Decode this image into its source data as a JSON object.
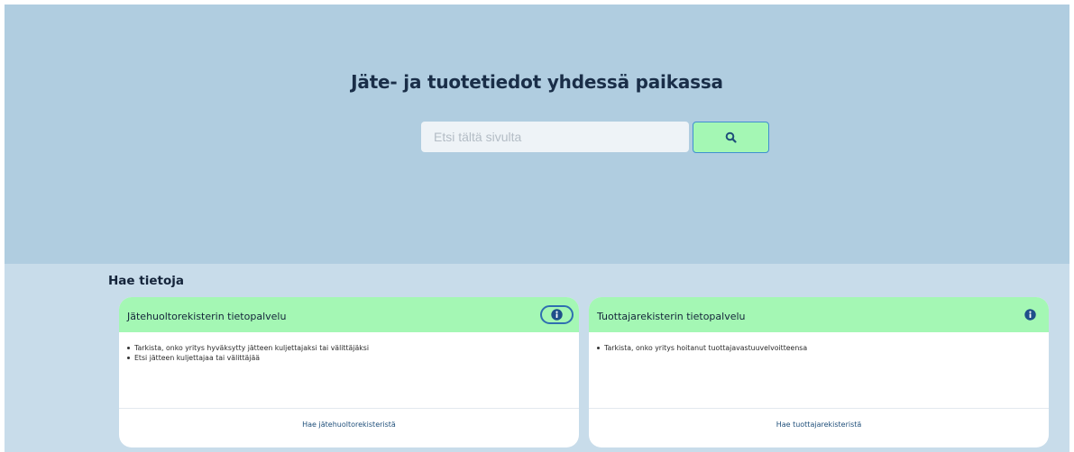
{
  "hero": {
    "title": "Jäte- ja tuotetiedot yhdessä paikassa",
    "search_placeholder": "Etsi tältä sivulta",
    "search_button_icon": "search-icon"
  },
  "section": {
    "title": "Hae tietoja"
  },
  "cards": [
    {
      "title": "Jätehuoltorekisterin tietopalvelu",
      "info_icon": "info-icon",
      "items": [
        "Tarkista, onko yritys hyväksytty jätteen kuljettajaksi tai välittäjäksi",
        "Etsi jätteen kuljettajaa tai välittäjää"
      ],
      "link": "Hae jätehuoltorekisteristä"
    },
    {
      "title": "Tuottajarekisterin tietopalvelu",
      "info_icon": "info-icon",
      "items": [
        "Tarkista, onko yritys hoitanut tuottajavastuuvelvoitteensa"
      ],
      "link": "Hae tuottajarekisteristä"
    }
  ],
  "colors": {
    "hero_bg": "#b0cde0",
    "lower_bg": "#c8dcea",
    "accent_green": "#a4f7b4",
    "info_blue": "#2f6fb0"
  }
}
